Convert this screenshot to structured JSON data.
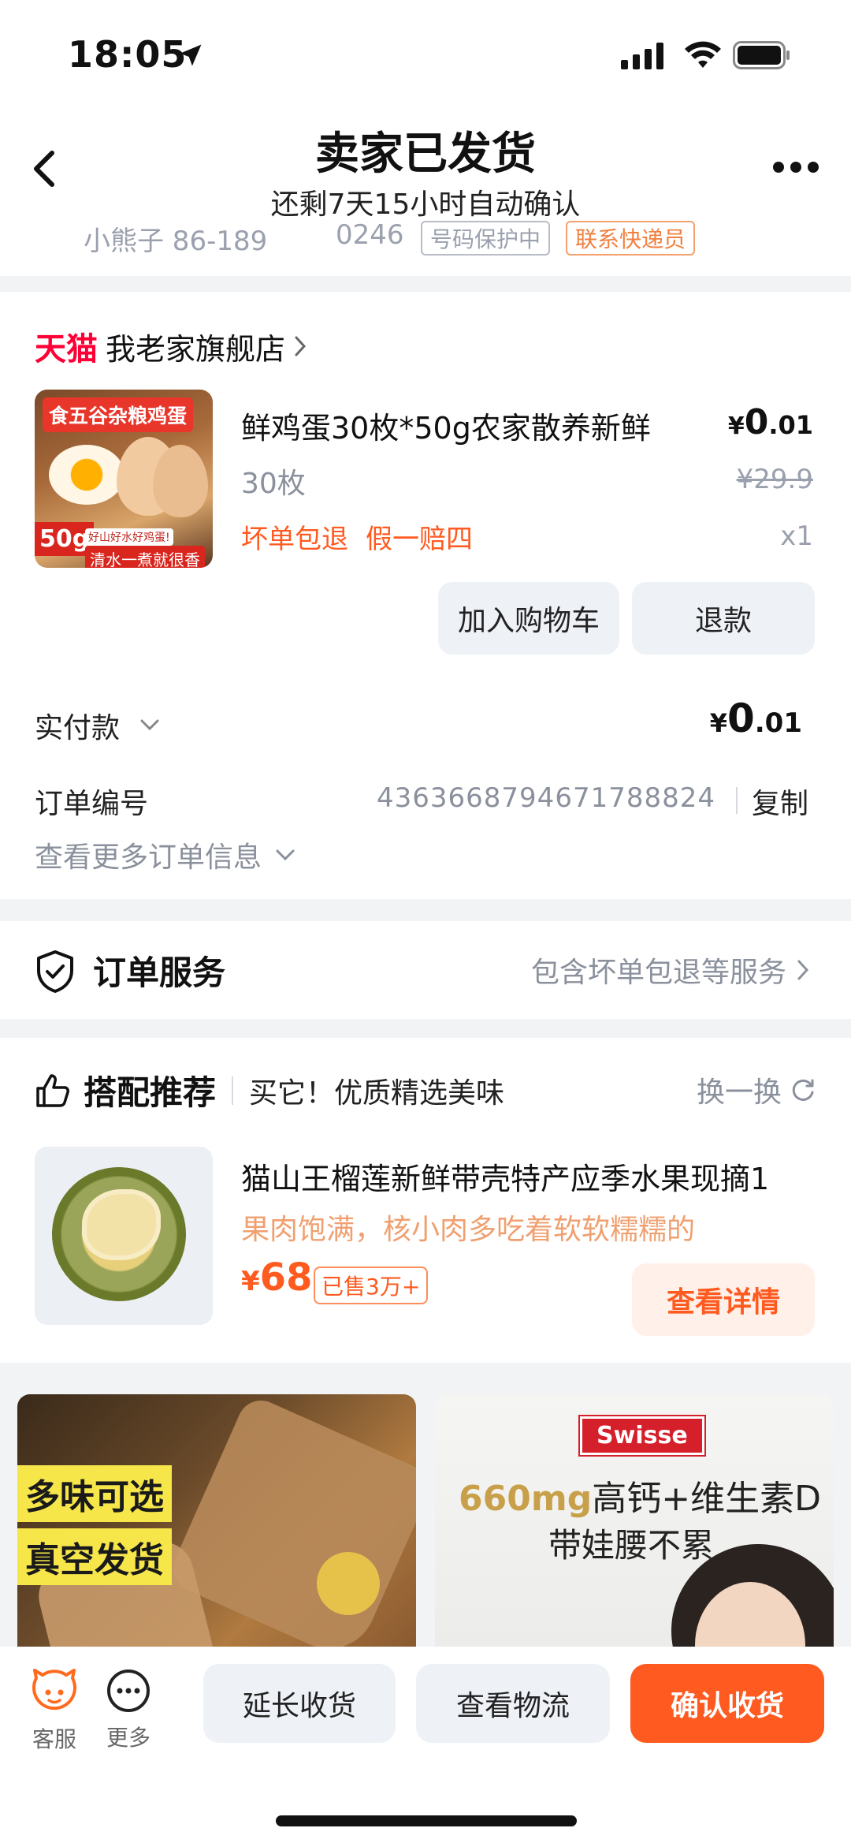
{
  "status_bar": {
    "time": "18:05"
  },
  "header": {
    "title": "卖家已发货",
    "subtitle": "还剩7天15小时自动确认",
    "ghost_row": [
      "小熊子 86-189",
      "0246",
      "号码保护中",
      "联系快递员"
    ]
  },
  "shop": {
    "brand": "天猫",
    "name": "我老家旗舰店"
  },
  "product": {
    "image_tags": {
      "top": "食五谷杂粮鸡蛋",
      "weight": "50g",
      "slogan": "好山好水好鸡蛋!",
      "bottom": "清水一煮就很香"
    },
    "title": "鲜鸡蛋30枚*50g农家散养新鲜",
    "spec": "30枚",
    "tags": [
      "坏单包退",
      "假一赔四"
    ],
    "price": {
      "currency": "¥",
      "int": "0",
      "dec": ".01"
    },
    "original_price": "¥29.9",
    "qty": "x1",
    "add_cart_label": "加入购物车",
    "refund_label": "退款"
  },
  "payment": {
    "label": "实付款",
    "amount": {
      "currency": "¥",
      "int": "0",
      "dec": ".01"
    }
  },
  "order": {
    "no_label": "订单编号",
    "no_value": "4363668794671788824",
    "copy_label": "复制",
    "more_info_label": "查看更多订单信息"
  },
  "service": {
    "title": "订单服务",
    "desc": "包含坏单包退等服务"
  },
  "recommend": {
    "title": "搭配推荐",
    "subtitle": "买它！优质精选美味",
    "swap_label": "换一换",
    "item": {
      "name": "猫山王榴莲新鲜带壳特产应季水果现摘1",
      "desc": "果肉饱满，核小肉多吃着软软糯糯的",
      "price_currency": "¥",
      "price": "68",
      "sold": "已售3万+",
      "detail_label": "查看详情"
    }
  },
  "promos": {
    "left": {
      "tag1": "多味可选",
      "tag2": "真空发货"
    },
    "right": {
      "brand": "Swisse",
      "highlight": "660mg",
      "line1_rest": "高钙+维生素D",
      "line2": "带娃腰不累"
    }
  },
  "bottom_bar": {
    "kefu_label": "客服",
    "more_label": "更多",
    "extend_label": "延长收货",
    "logistics_label": "查看物流",
    "confirm_label": "确认收货"
  },
  "colors": {
    "accent": "#ff5a1f",
    "tmall": "#ff0036",
    "muted": "#8a909c",
    "soft_bg": "#eef1f6"
  }
}
